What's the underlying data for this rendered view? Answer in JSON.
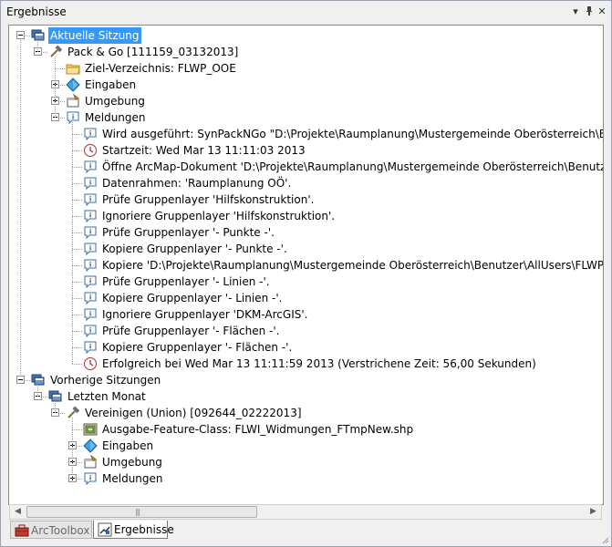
{
  "window": {
    "title": "Ergebnisse"
  },
  "tree": [
    {
      "label": "Aktuelle Sitzung",
      "icon": "session-icon",
      "depth": 0,
      "expander": "minus",
      "selected": true
    },
    {
      "label": "Pack & Go [111159_03132013]",
      "icon": "hammer-icon",
      "depth": 1,
      "expander": "minus"
    },
    {
      "label": "Ziel-Verzeichnis: FLWP_OOE",
      "icon": "folder-icon",
      "depth": 2,
      "expander": "none"
    },
    {
      "label": "Eingaben",
      "icon": "input-diamond-icon",
      "depth": 2,
      "expander": "plus"
    },
    {
      "label": "Umgebung",
      "icon": "environment-icon",
      "depth": 2,
      "expander": "plus"
    },
    {
      "label": "Meldungen",
      "icon": "message-icon",
      "depth": 2,
      "expander": "minus"
    },
    {
      "label": "Wird ausgeführt: SynPackNGo \"D:\\Projekte\\Raumplanung\\Mustergemeinde Oberösterreich\\Benutzer\\All",
      "icon": "message-icon",
      "depth": 3,
      "expander": "none"
    },
    {
      "label": "Startzeit: Wed Mar 13 11:11:03 2013",
      "icon": "clock-icon",
      "depth": 3,
      "expander": "none"
    },
    {
      "label": "Öffne ArcMap-Dokument 'D:\\Projekte\\Raumplanung\\Mustergemeinde Oberösterreich\\Benutzer\\AllUser",
      "icon": "message-icon",
      "depth": 3,
      "expander": "none"
    },
    {
      "label": "Datenrahmen: 'Raumplanung OÖ'.",
      "icon": "message-icon",
      "depth": 3,
      "expander": "none"
    },
    {
      "label": "Prüfe Gruppenlayer 'Hilfskonstruktion'.",
      "icon": "message-icon",
      "depth": 3,
      "expander": "none"
    },
    {
      "label": "Ignoriere Gruppenlayer 'Hilfskonstruktion'.",
      "icon": "message-icon",
      "depth": 3,
      "expander": "none"
    },
    {
      "label": "Prüfe Gruppenlayer '- Punkte -'.",
      "icon": "message-icon",
      "depth": 3,
      "expander": "none"
    },
    {
      "label": "Kopiere Gruppenlayer '- Punkte -'.",
      "icon": "message-icon",
      "depth": 3,
      "expander": "none"
    },
    {
      "label": "Kopiere 'D:\\Projekte\\Raumplanung\\Mustergemeinde Oberösterreich\\Benutzer\\AllUsers\\FLWP_OOE.mxd'",
      "icon": "message-icon",
      "depth": 3,
      "expander": "none"
    },
    {
      "label": "Prüfe Gruppenlayer '- Linien -'.",
      "icon": "message-icon",
      "depth": 3,
      "expander": "none"
    },
    {
      "label": "Kopiere Gruppenlayer '- Linien -'.",
      "icon": "message-icon",
      "depth": 3,
      "expander": "none"
    },
    {
      "label": "Ignoriere Gruppenlayer 'DKM-ArcGIS'.",
      "icon": "message-icon",
      "depth": 3,
      "expander": "none"
    },
    {
      "label": "Prüfe Gruppenlayer '- Flächen -'.",
      "icon": "message-icon",
      "depth": 3,
      "expander": "none"
    },
    {
      "label": "Kopiere Gruppenlayer '- Flächen -'.",
      "icon": "message-icon",
      "depth": 3,
      "expander": "none"
    },
    {
      "label": "Erfolgreich bei Wed Mar 13 11:11:59 2013 (Verstrichene Zeit: 56,00 Sekunden)",
      "icon": "clock-icon",
      "depth": 3,
      "expander": "none"
    },
    {
      "label": "Vorherige Sitzungen",
      "icon": "session-icon",
      "depth": 0,
      "expander": "minus"
    },
    {
      "label": "Letzten Monat",
      "icon": "session-icon",
      "depth": 1,
      "expander": "minus"
    },
    {
      "label": "Vereinigen (Union) [092644_02222013]",
      "icon": "hammer-icon",
      "depth": 2,
      "expander": "minus"
    },
    {
      "label": "Ausgabe-Feature-Class: FLWI_Widmungen_FTmpNew.shp",
      "icon": "feature-class-icon",
      "depth": 3,
      "expander": "none"
    },
    {
      "label": "Eingaben",
      "icon": "input-diamond-icon",
      "depth": 3,
      "expander": "plus"
    },
    {
      "label": "Umgebung",
      "icon": "environment-icon",
      "depth": 3,
      "expander": "plus"
    },
    {
      "label": "Meldungen",
      "icon": "message-icon",
      "depth": 3,
      "expander": "plus"
    }
  ],
  "tabs": [
    {
      "label": "ArcToolbox",
      "icon": "toolbox-icon",
      "active": false
    },
    {
      "label": "Ergebnisse",
      "icon": "results-icon",
      "active": true
    }
  ],
  "colors": {
    "selection": "#3399ff",
    "accent": "#1e6fd0"
  }
}
